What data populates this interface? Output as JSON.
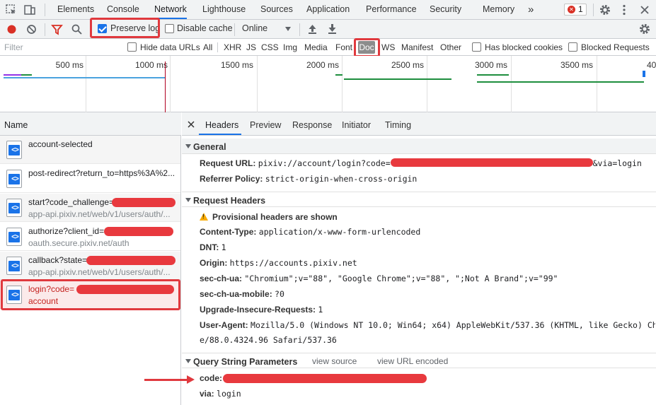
{
  "tabs": [
    {
      "label": "Elements"
    },
    {
      "label": "Console"
    },
    {
      "label": "Network"
    },
    {
      "label": "Lighthouse"
    },
    {
      "label": "Sources"
    },
    {
      "label": "Application"
    },
    {
      "label": "Performance"
    },
    {
      "label": "Security"
    },
    {
      "label": "Memory"
    }
  ],
  "more_tabs": "»",
  "error_count": "1",
  "toolbar": {
    "preserve_log": "Preserve log",
    "preserve_log_checked": true,
    "disable_cache": "Disable cache",
    "throttle": "Online"
  },
  "filter": {
    "placeholder": "Filter",
    "hide_data_urls": "Hide data URLs",
    "types": [
      "All",
      "XHR",
      "JS",
      "CSS",
      "Img",
      "Media",
      "Font",
      "Doc",
      "WS",
      "Manifest",
      "Other"
    ],
    "selected_type": "Doc",
    "has_blocked_cookies": "Has blocked cookies",
    "blocked_requests": "Blocked Requests"
  },
  "overview": {
    "ticks": [
      "500 ms",
      "1000 ms",
      "1500 ms",
      "2000 ms",
      "2500 ms",
      "3000 ms",
      "3500 ms",
      "40"
    ]
  },
  "list": {
    "header": "Name",
    "requests": [
      {
        "name": "account-selected",
        "domain": ""
      },
      {
        "name": "post-redirect?return_to=https%3A%2...",
        "domain": ""
      },
      {
        "name": "start?code_challenge=",
        "domain": "app-api.pixiv.net/web/v1/users/auth/..."
      },
      {
        "name": "authorize?client_id=",
        "domain": "oauth.secure.pixiv.net/auth"
      },
      {
        "name": "callback?state=",
        "domain": "app-api.pixiv.net/web/v1/users/auth/..."
      },
      {
        "name": "login?code=",
        "domain": "account"
      }
    ]
  },
  "details": {
    "tabs": [
      "Headers",
      "Preview",
      "Response",
      "Initiator",
      "Timing"
    ],
    "general": {
      "title": "General",
      "request_url_key": "Request URL:",
      "request_url_prefix": "pixiv://account/login?code=",
      "request_url_suffix": "&via=login",
      "referrer_policy_key": "Referrer Policy:",
      "referrer_policy_value": "strict-origin-when-cross-origin"
    },
    "request_headers": {
      "title": "Request Headers",
      "provisional": "Provisional headers are shown",
      "rows": [
        {
          "key": "Content-Type:",
          "value": "application/x-www-form-urlencoded"
        },
        {
          "key": "DNT:",
          "value": "1"
        },
        {
          "key": "Origin:",
          "value": "https://accounts.pixiv.net"
        },
        {
          "key": "sec-ch-ua:",
          "value": "\"Chromium\";v=\"88\", \"Google Chrome\";v=\"88\", \";Not A Brand\";v=\"99\""
        },
        {
          "key": "sec-ch-ua-mobile:",
          "value": "?0"
        },
        {
          "key": "Upgrade-Insecure-Requests:",
          "value": "1"
        },
        {
          "key": "User-Agent:",
          "value": "Mozilla/5.0 (Windows NT 10.0; Win64; x64) AppleWebKit/537.36 (KHTML, like Gecko) Chrom"
        }
      ],
      "user_agent_cont": "e/88.0.4324.96 Safari/537.36"
    },
    "query_params": {
      "title": "Query String Parameters",
      "view_source": "view source",
      "view_url_encoded": "view URL encoded",
      "code_key": "code:",
      "via_key": "via:",
      "via_value": "login"
    }
  }
}
